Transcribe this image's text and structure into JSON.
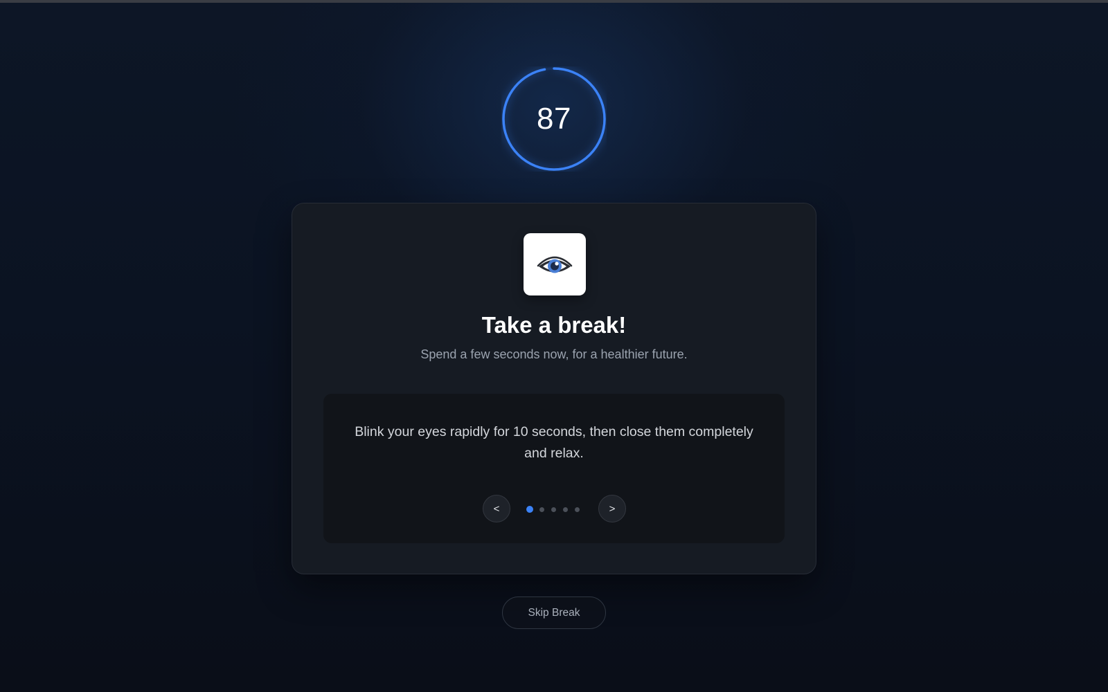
{
  "timer": {
    "seconds_remaining": "87",
    "progress_fraction": 0.97,
    "ring_color": "#3b82f6"
  },
  "card": {
    "icon": "eye-icon",
    "title": "Take a break!",
    "subtitle": "Spend a few seconds now, for a healthier future.",
    "tip": {
      "text": "Blink your eyes rapidly for 10 seconds, then close them completely and relax.",
      "prev_label": "<",
      "next_label": ">",
      "page_count": 5,
      "active_page": 1
    }
  },
  "skip_button": {
    "label": "Skip Break"
  },
  "colors": {
    "accent": "#3b82f6",
    "background": "#0b1322",
    "card": "#161b23"
  }
}
